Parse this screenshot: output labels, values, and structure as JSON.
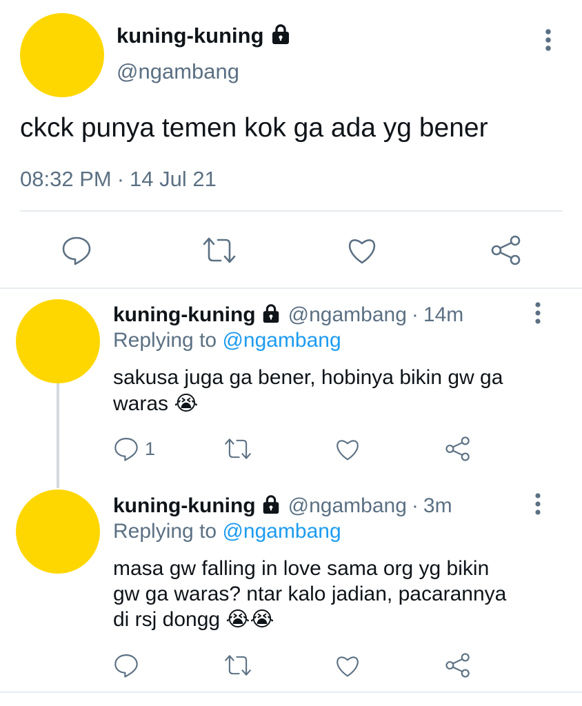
{
  "main_tweet": {
    "display_name": "kuning-kuning",
    "handle": "@ngambang",
    "text": "ckck punya temen kok ga ada yg bener",
    "time": "08:32 PM",
    "separator": "·",
    "date": "14 Jul 21"
  },
  "replies": [
    {
      "display_name": "kuning-kuning",
      "handle": "@ngambang",
      "separator": "·",
      "age": "14m",
      "replying_prefix": "Replying to",
      "replying_handle": "@ngambang",
      "text_line1": "sakusa juga ga bener, hobinya bikin gw ga",
      "text_line2": "waras 😭",
      "reply_count": "1"
    },
    {
      "display_name": "kuning-kuning",
      "handle": "@ngambang",
      "separator": "·",
      "age": "3m",
      "replying_prefix": "Replying to",
      "replying_handle": "@ngambang",
      "text_line1": "masa gw falling in love sama org yg bikin",
      "text_line2": "gw ga waras? ntar kalo jadian, pacarannya",
      "text_line3": "di rsj dongg 😭😭",
      "reply_count": ""
    }
  ],
  "icons": {
    "lock": "lock-icon",
    "more": "more-vertical-icon",
    "reply": "reply-icon",
    "retweet": "retweet-icon",
    "like": "heart-icon",
    "share": "share-icon"
  },
  "colors": {
    "avatar": "#FFD700",
    "muted": "#5b7083",
    "link": "#1d9bf0",
    "divider": "#e6ecf0"
  }
}
